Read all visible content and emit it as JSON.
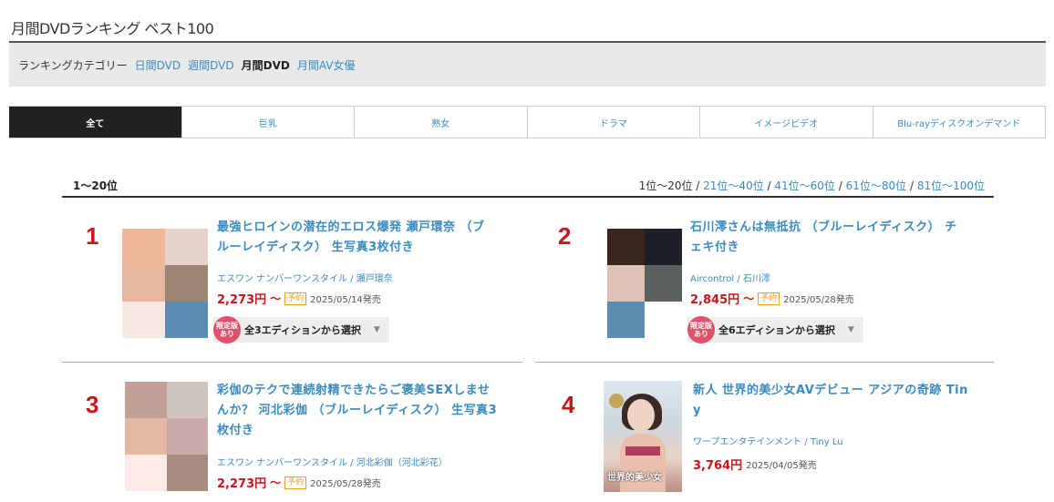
{
  "page": {
    "title": "月間DVDランキング ベスト100"
  },
  "category_bar": {
    "label": "ランキングカテゴリー",
    "links": [
      {
        "label": "日間DVD",
        "active": false
      },
      {
        "label": "週間DVD",
        "active": false
      },
      {
        "label": "月間DVD",
        "active": true
      },
      {
        "label": "月間AV女優",
        "active": false
      }
    ]
  },
  "genre_tabs": [
    {
      "label": "全て",
      "active": true
    },
    {
      "label": "巨乳",
      "active": false
    },
    {
      "label": "熟女",
      "active": false
    },
    {
      "label": "ドラマ",
      "active": false
    },
    {
      "label": "イメージビデオ",
      "active": false
    },
    {
      "label": "Blu-rayディスクオンデマンド",
      "active": false
    }
  ],
  "range": {
    "label": "1〜20位"
  },
  "pager": {
    "pages": [
      {
        "label": "1位〜20位",
        "current": true
      },
      {
        "label": "21位〜40位",
        "current": false
      },
      {
        "label": "41位〜60位",
        "current": false
      },
      {
        "label": "61位〜80位",
        "current": false
      },
      {
        "label": "81位〜100位",
        "current": false
      }
    ],
    "separator": " / "
  },
  "items": [
    {
      "rank": "1",
      "title_line1": "最強ヒロインの潜在的エロス爆発 瀬戸環奈 （ブ",
      "title_line2": "ルーレイディスク） 生写真3枚付き",
      "maker": "エスワン ナンバーワンスタイル",
      "actress": "瀬戸環奈",
      "price": "2,273円",
      "price_suffix": "〜",
      "yoyaku": "予約",
      "release": "2025/05/14発売",
      "limited": "限定版あり",
      "edition": "全3エディションから選択",
      "thumb_colors": [
        "#f0b89a",
        "#e6d3ca",
        "#e8b7a0",
        "#9a8572",
        "#f6e8e2",
        "#5b8cb3"
      ]
    },
    {
      "rank": "2",
      "title_line1": "石川澪さんは無抵抗 （ブルーレイディスク） チ",
      "title_line2": "ェキ付き",
      "maker": "Aircontrol",
      "actress": "石川澪",
      "price": "2,845円",
      "price_suffix": "〜",
      "yoyaku": "予約",
      "release": "2025/05/28発売",
      "limited": "限定版あり",
      "edition": "全6エディションから選択",
      "thumb_colors": [
        "#3a261c",
        "#1e2027",
        "#dfc2b6",
        "#5b615e",
        "#5c8dae",
        "#ffffff"
      ]
    },
    {
      "rank": "3",
      "title_line1": "彩伽のテクで連続射精できたらご褒美SEXしませ",
      "title_line2": "んか？ 河北彩伽 （ブルーレイディスク） 生写真3",
      "title_line3": "枚付き",
      "maker": "エスワン ナンバーワンスタイル",
      "actress": "河北彩伽（河北彩花）",
      "price": "2,273円",
      "price_suffix": "〜",
      "yoyaku": "予約",
      "release": "2025/05/28発売",
      "thumb_colors": [
        "#c2a095",
        "#cfc4bb",
        "#e3b8a4",
        "#c9aaaa",
        "#fde9e8",
        "#a88a7e"
      ]
    },
    {
      "rank": "4",
      "title_line1": "新人 世界的美少女AVデビュー アジアの奇跡 Tin",
      "title_line2": "y",
      "maker": "ワープエンタテインメント",
      "actress": "Tiny Lu",
      "price": "3,764円",
      "release": "2025/04/05発売",
      "cover_text": "世界的美少女"
    }
  ]
}
